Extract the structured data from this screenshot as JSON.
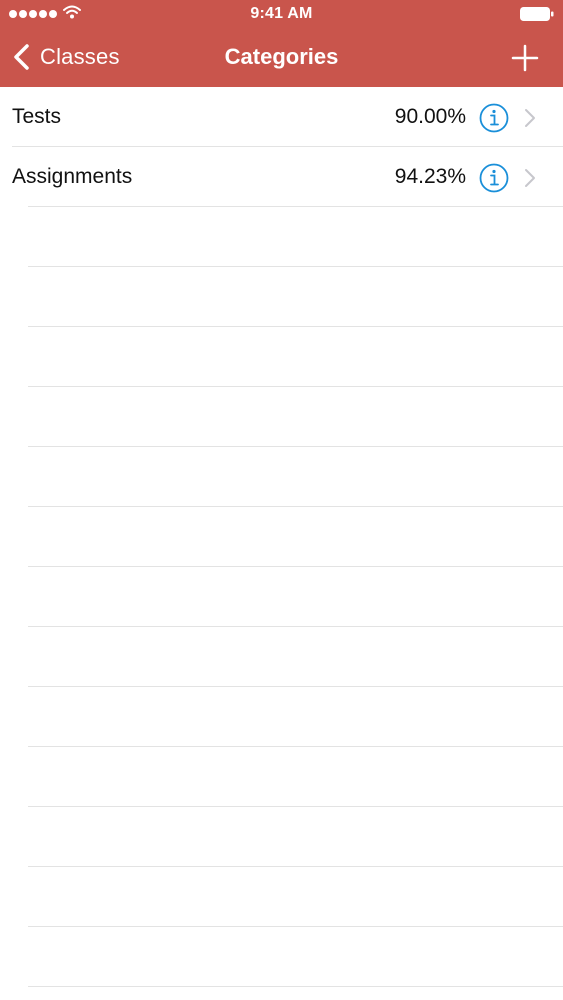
{
  "colors": {
    "accent": "#c9554c",
    "info_blue": "#1a8fd9",
    "separator": "#e3e3e3",
    "chevron": "#c7c7cc"
  },
  "status_bar": {
    "time": "9:41 AM",
    "signal_icon": "signal-dots-icon",
    "wifi_icon": "wifi-icon",
    "battery_icon": "battery-icon"
  },
  "nav_bar": {
    "back_label": "Classes",
    "back_icon": "chevron-left-icon",
    "title": "Categories",
    "add_icon": "plus-icon"
  },
  "categories": [
    {
      "name": "Tests",
      "percent": "90.00%"
    },
    {
      "name": "Assignments",
      "percent": "94.23%"
    }
  ],
  "row_icons": {
    "info": "info-circle-icon",
    "disclosure": "chevron-right-icon"
  }
}
